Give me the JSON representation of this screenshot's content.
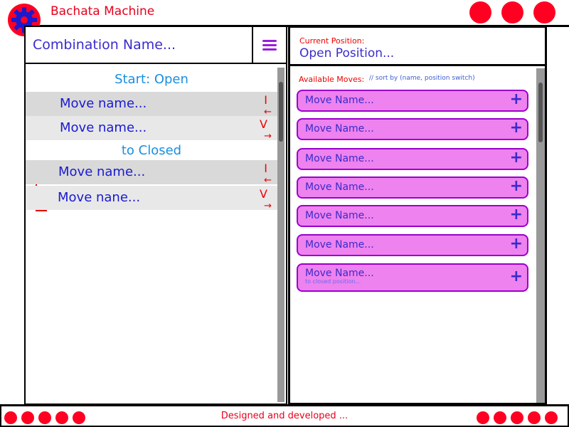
{
  "header": {
    "title": "Bachata Machine",
    "logo_icon": "gear-icon",
    "window_buttons": [
      "circle-button",
      "circle-button",
      "circle-button"
    ]
  },
  "left": {
    "combination_placeholder": "Combination Name...",
    "menu_icon": "hamburger-menu-icon",
    "start_label": "Start: Open",
    "transition_label": "to Closed",
    "moves": [
      {
        "name": "Move name...",
        "glyph": "I",
        "arrow": "←"
      },
      {
        "name": "Move name...",
        "glyph": "V",
        "arrow": "→"
      },
      {
        "name": "Move name...",
        "glyph": "I",
        "arrow": "←"
      },
      {
        "name": "Move nane...",
        "glyph": "V",
        "arrow": "→"
      }
    ]
  },
  "right": {
    "current_position_label": "Current Position:",
    "current_position": "Open Position...",
    "available_label": "Available Moves:",
    "sort_hint": "// sort by (name, position switch)",
    "cards": [
      {
        "name": "Move Name...",
        "action": "+"
      },
      {
        "name": "Move Name...",
        "action": "+"
      },
      {
        "name": "Move Name...",
        "action": "+"
      },
      {
        "name": "Move Name...",
        "action": "+"
      },
      {
        "name": "Move Name...",
        "action": "+"
      },
      {
        "name": "Move Name...",
        "action": "+"
      },
      {
        "name": "Move Name...",
        "action": "+",
        "subtitle": "to closed position..."
      }
    ]
  },
  "footer": {
    "text": "Designed and developed ..."
  },
  "colors": {
    "accent_red": "#ff0022",
    "card_fill": "#ee82ee",
    "card_border": "#9b00cc",
    "text_blue": "#3a2bcc",
    "green_bracket": "#2ecc40",
    "red_bracket": "#e00000"
  }
}
